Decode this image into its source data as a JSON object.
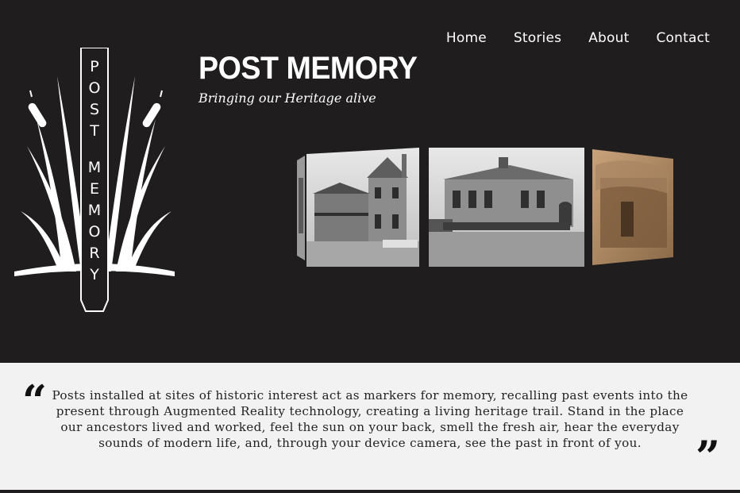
{
  "nav": {
    "items": [
      {
        "label": "Home"
      },
      {
        "label": "Stories"
      },
      {
        "label": "About"
      },
      {
        "label": "Contact"
      }
    ]
  },
  "logo": {
    "wordmark": "POST MEMORY",
    "icon": "raupo-reeds-post-icon"
  },
  "header": {
    "title": "POST MEMORY",
    "subtitle": "Bringing our Heritage alive"
  },
  "carousel": {
    "slides": [
      {
        "icon": "historic-photo-partial"
      },
      {
        "icon": "historic-photo-villa"
      },
      {
        "icon": "historic-photo-schoolhouse"
      },
      {
        "icon": "historic-photo-cottage"
      }
    ]
  },
  "quote": {
    "open_mark": "“",
    "close_mark": "”",
    "text": "Posts installed at sites of historic interest act as markers for memory, recalling past events into the present through Augmented Reality technology, creating a living heritage trail. Stand in the place our ancestors lived and worked, feel the sun on your back, smell the fresh air, hear the everyday sounds of modern life, and, through your device camera, see the past in front of you."
  },
  "colors": {
    "background": "#1f1d1e",
    "band": "#f2f2f2",
    "text_light": "#ffffff",
    "text_dark": "#222222"
  }
}
